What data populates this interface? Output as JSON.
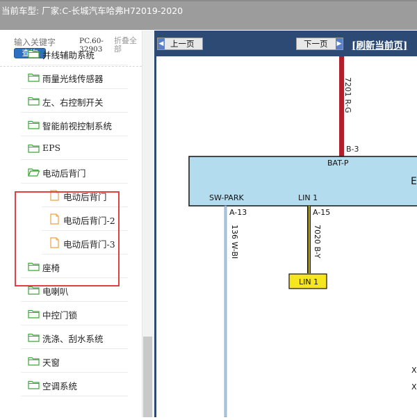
{
  "window": {
    "caption": "当前车型:  厂家:C-长城汽车哈弗H72019-2020"
  },
  "search": {
    "placeholder": "输入关键字",
    "button_label": "查询",
    "pc_code": "PC.60-32903",
    "fold_all_label": "折叠全部"
  },
  "tree": {
    "items": [
      {
        "label": "并线辅助系统",
        "type": "folder"
      },
      {
        "label": "雨量光线传感器",
        "type": "folder"
      },
      {
        "label": "左、右控制开关",
        "type": "folder"
      },
      {
        "label": "智能前视控制系统",
        "type": "folder"
      },
      {
        "label": "EPS",
        "type": "folder"
      },
      {
        "label": "电动后背门",
        "type": "folder-open"
      },
      {
        "label": "电动后背门",
        "type": "file"
      },
      {
        "label": "电动后背门-2",
        "type": "file"
      },
      {
        "label": "电动后背门-3",
        "type": "file"
      },
      {
        "label": "座椅",
        "type": "folder"
      },
      {
        "label": "电喇叭",
        "type": "folder"
      },
      {
        "label": "中控门锁",
        "type": "folder"
      },
      {
        "label": "洗涤、刮水系统",
        "type": "folder"
      },
      {
        "label": "天窗",
        "type": "folder"
      },
      {
        "label": "空调系统",
        "type": "folder"
      }
    ]
  },
  "nav": {
    "prev_label": "上一页",
    "next_label": "下一页",
    "refresh_label": "[刷新当前页]"
  },
  "diagram": {
    "wire_top_label": "7201 R-G",
    "pin_top": "B-3",
    "bat_label": "BAT-P",
    "module_label_partial": "E",
    "sw_park_label": "SW-PARK",
    "lin_label": "LIN 1",
    "pin_a13": "A-13",
    "pin_a15": "A-15",
    "wire_left_label": "136 W-BI",
    "wire_mid_label": "7020 B-Y",
    "lin_box_label": "LIN 1",
    "right_edge_1": "X",
    "right_edge_2": "X"
  },
  "colors": {
    "titlebar": "#9c9c9c",
    "search_button": "#2f6fbf",
    "highlight_border": "#e04040",
    "folder_green": "#3aa635",
    "file_orange": "#f0a040",
    "panel_navy": "#2c4a74",
    "module_fill": "#b3dcef",
    "wire_red": "#b0202c",
    "lin_box_fill": "#f5e61e"
  }
}
